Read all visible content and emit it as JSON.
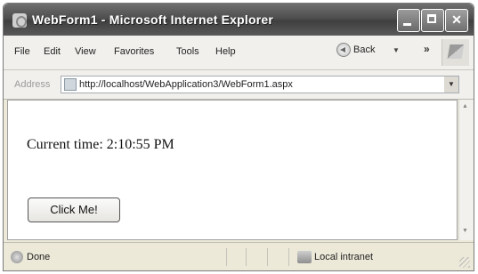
{
  "window": {
    "title": "WebForm1 - Microsoft Internet Explorer",
    "controls": {
      "minimize": "minimize",
      "maximize": "maximize",
      "close": "✕"
    }
  },
  "menu": {
    "items": [
      "File",
      "Edit",
      "View",
      "Favorites",
      "Tools",
      "Help"
    ],
    "back_label": "Back",
    "more": "»"
  },
  "address": {
    "label": "Address",
    "url": "http://localhost/WebApplication3/WebForm1.aspx"
  },
  "page": {
    "time_label": "Current time: 2:10:55 PM",
    "button_label": "Click Me!"
  },
  "status": {
    "left": "Done",
    "zone": "Local intranet"
  },
  "icons": [
    "ie-app-icon",
    "back-icon",
    "page-icon",
    "windows-logo-icon",
    "done-icon",
    "local-intranet-icon"
  ]
}
